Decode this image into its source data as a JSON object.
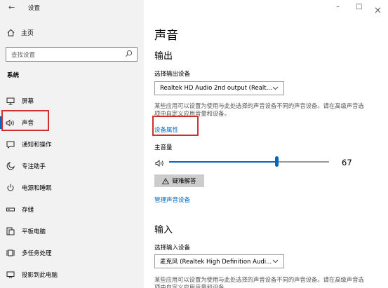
{
  "titlebar": {
    "back_icon": "←",
    "title": "设置",
    "minimize": "–",
    "maximize": "□"
  },
  "sidebar": {
    "home_label": "主页",
    "search_placeholder": "查找设置",
    "section_label": "系统",
    "items": [
      {
        "label": "屏幕",
        "icon": "monitor-icon"
      },
      {
        "label": "声音",
        "icon": "speaker-icon",
        "selected": true
      },
      {
        "label": "通知和操作",
        "icon": "notification-icon"
      },
      {
        "label": "专注助手",
        "icon": "moon-icon"
      },
      {
        "label": "电源和睡眠",
        "icon": "power-icon"
      },
      {
        "label": "存储",
        "icon": "storage-icon"
      },
      {
        "label": "平板电脑",
        "icon": "tablet-icon"
      },
      {
        "label": "多任务处理",
        "icon": "multitask-icon"
      },
      {
        "label": "投影到此电脑",
        "icon": "project-icon"
      }
    ]
  },
  "main": {
    "title": "声音",
    "output": {
      "heading": "输出",
      "select_label": "选择输出设备",
      "device": "Realtek HD Audio 2nd output (Realt...",
      "description": "某些应用可以设置为使用与此处选择的声音设备不同的声音设备。请在高级声音选项中自定义应用音量和设备。",
      "properties_link": "设备属性",
      "volume_label": "主音量",
      "volume_value": "67",
      "volume_level": 0.67,
      "troubleshoot_label": "疑难解答",
      "manage_link": "管理声音设备"
    },
    "input": {
      "heading": "输入",
      "select_label": "选择输入设备",
      "device": "麦克风 (Realtek High Definition Audi...",
      "description": "某些应用可以设置为使用与此处选择的声音设备不同的声音设备。请在高级声音选项中自定义应用音量和设备。"
    }
  },
  "colors": {
    "accent": "#0067c0",
    "highlight": "#d32f2f",
    "sidebar_bg": "#f2f2f2"
  }
}
